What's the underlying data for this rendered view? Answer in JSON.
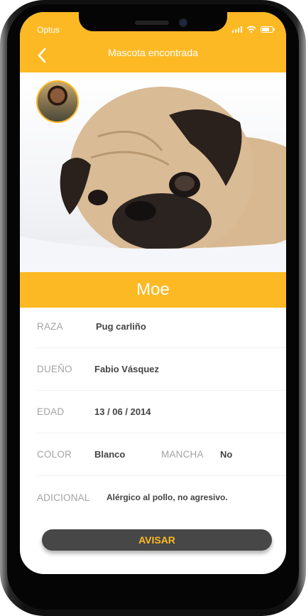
{
  "status_bar": {
    "carrier": "Optus"
  },
  "header": {
    "title": "Mascota encontrada",
    "back_icon": "chevron-left-icon"
  },
  "pet": {
    "name": "Moe"
  },
  "details": {
    "breed": {
      "label": "RAZA",
      "value": "Pug carliño"
    },
    "owner": {
      "label": "DUEÑO",
      "value": "Fabio Vásquez"
    },
    "age": {
      "label": "EDAD",
      "value": "13 / 06 / 2014"
    },
    "color": {
      "label": "COLOR",
      "value": "Blanco"
    },
    "spot": {
      "label": "MANCHA",
      "value": "No"
    },
    "extra": {
      "label": "ADICIONAL",
      "value": "Alérgico al pollo, no agresivo."
    }
  },
  "action": {
    "label": "AVISAR"
  },
  "colors": {
    "accent": "#FDB924",
    "button": "#474747"
  }
}
